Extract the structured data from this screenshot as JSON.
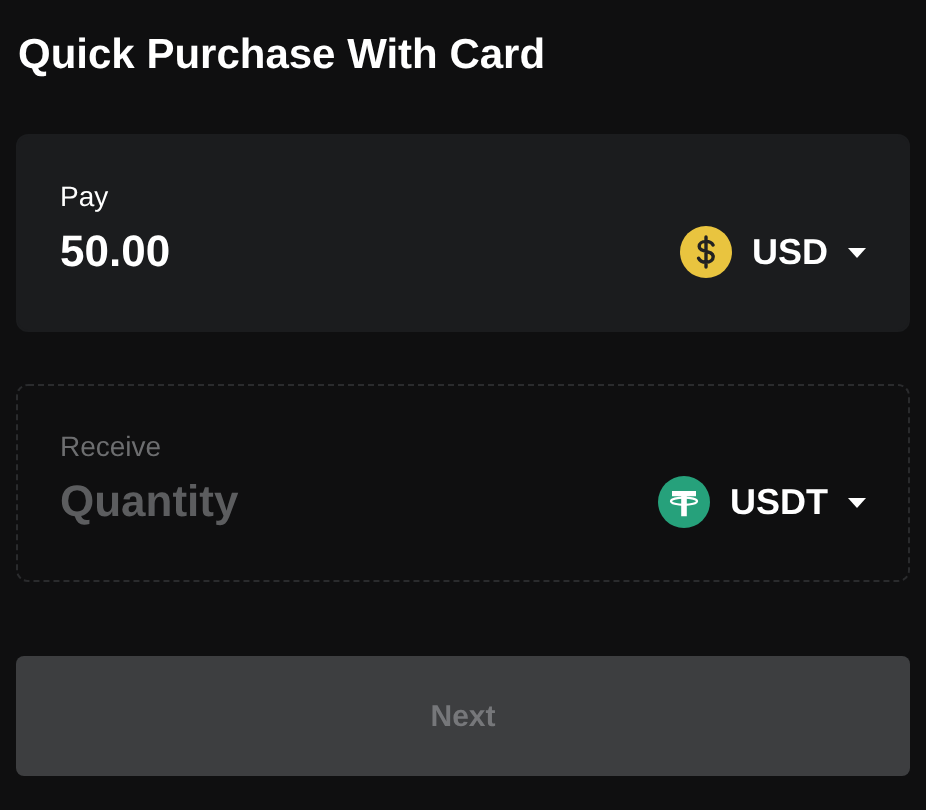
{
  "title": "Quick Purchase With Card",
  "sections": [
    {
      "kind": "pay",
      "label": "Pay",
      "value": "50.00",
      "currency": {
        "code": "USD",
        "kind": "dollar"
      }
    },
    {
      "kind": "receive",
      "label": "Receive",
      "placeholder": "Quantity",
      "currency": {
        "code": "USDT",
        "kind": "tether"
      }
    }
  ],
  "next_button": {
    "label": "Next",
    "disabled": true
  }
}
